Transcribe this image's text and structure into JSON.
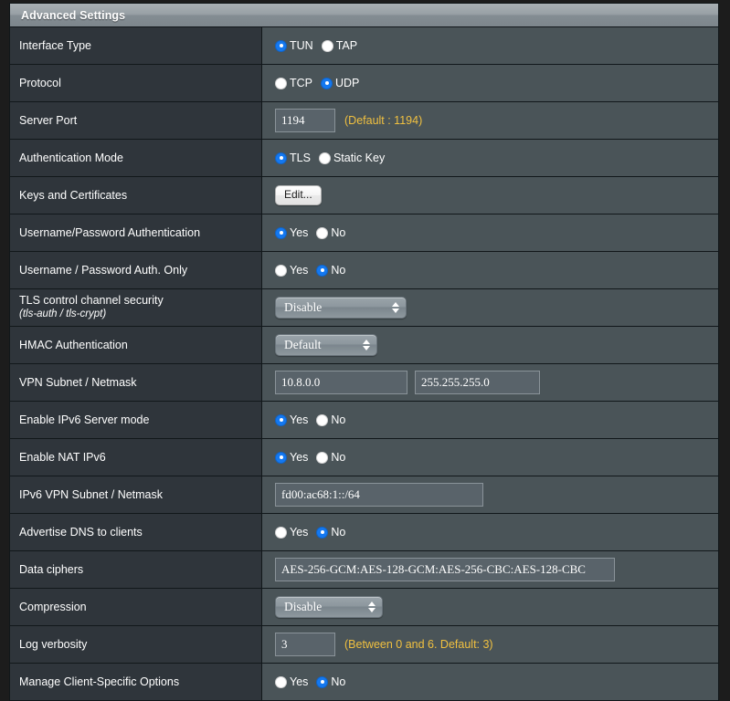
{
  "header": {
    "title": "Advanced Settings"
  },
  "rows": [
    {
      "label": "Interface Type",
      "type": "radio",
      "options": [
        {
          "label": "TUN",
          "selected": true
        },
        {
          "label": "TAP",
          "selected": false
        }
      ]
    },
    {
      "label": "Protocol",
      "type": "radio",
      "options": [
        {
          "label": "TCP",
          "selected": false
        },
        {
          "label": "UDP",
          "selected": true
        }
      ]
    },
    {
      "label": "Server Port",
      "type": "text",
      "value": "1194",
      "hint": "(Default : 1194)"
    },
    {
      "label": "Authentication Mode",
      "type": "radio",
      "options": [
        {
          "label": "TLS",
          "selected": true
        },
        {
          "label": "Static Key",
          "selected": false
        }
      ]
    },
    {
      "label": "Keys and Certificates",
      "type": "button",
      "button_label": "Edit..."
    },
    {
      "label": "Username/Password Authentication",
      "type": "radio",
      "options": [
        {
          "label": "Yes",
          "selected": true
        },
        {
          "label": "No",
          "selected": false
        }
      ]
    },
    {
      "label": "Username / Password Auth. Only",
      "type": "radio",
      "options": [
        {
          "label": "Yes",
          "selected": false
        },
        {
          "label": "No",
          "selected": true
        }
      ]
    },
    {
      "label": "TLS control channel security",
      "sublabel": "(tls-auth / tls-crypt)",
      "type": "select",
      "value": "Disable"
    },
    {
      "label": "HMAC Authentication",
      "type": "select",
      "value": "Default"
    },
    {
      "label": "VPN Subnet / Netmask",
      "type": "text2",
      "value": "10.8.0.0",
      "value2": "255.255.255.0"
    },
    {
      "label": "Enable IPv6 Server mode",
      "type": "radio",
      "options": [
        {
          "label": "Yes",
          "selected": true
        },
        {
          "label": "No",
          "selected": false
        }
      ]
    },
    {
      "label": "Enable NAT IPv6",
      "type": "radio",
      "options": [
        {
          "label": "Yes",
          "selected": true
        },
        {
          "label": "No",
          "selected": false
        }
      ]
    },
    {
      "label": "IPv6 VPN Subnet / Netmask",
      "type": "text",
      "value": "fd00:ac68:1::/64"
    },
    {
      "label": "Advertise DNS to clients",
      "type": "radio",
      "options": [
        {
          "label": "Yes",
          "selected": false
        },
        {
          "label": "No",
          "selected": true
        }
      ]
    },
    {
      "label": "Data ciphers",
      "type": "text",
      "value": "AES-256-GCM:AES-128-GCM:AES-256-CBC:AES-128-CBC"
    },
    {
      "label": "Compression",
      "type": "select",
      "value": "Disable"
    },
    {
      "label": "Log verbosity",
      "type": "text",
      "value": "3",
      "hint": "(Between 0 and 6. Default: 3)"
    },
    {
      "label": "Manage Client-Specific Options",
      "type": "radio",
      "options": [
        {
          "label": "Yes",
          "selected": false
        },
        {
          "label": "No",
          "selected": true
        }
      ]
    }
  ],
  "colors": {
    "accent_radio": "#1478f0",
    "hint_text": "#f0c040",
    "label_column_bg": "#2f353b",
    "value_column_bg": "#4a5458",
    "panel_border": "#11171a"
  }
}
